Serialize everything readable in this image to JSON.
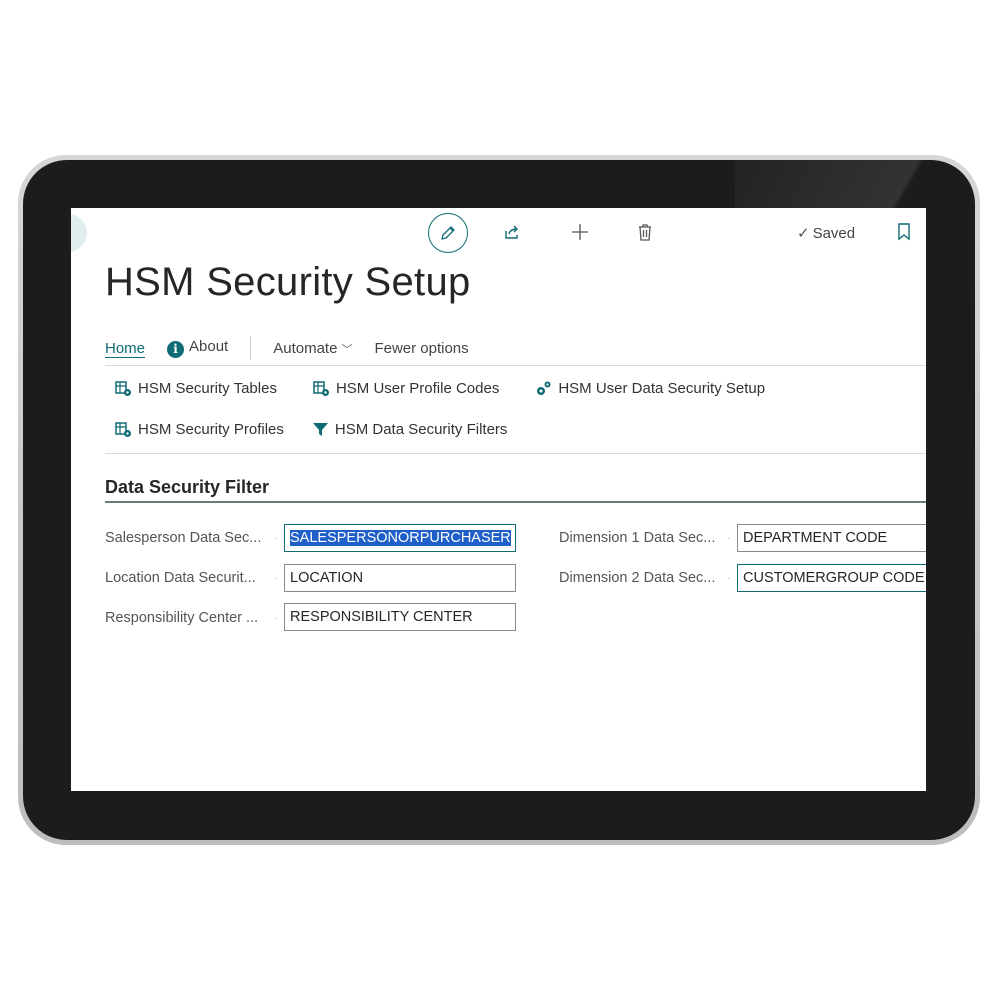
{
  "toolbar": {
    "saved_label": "Saved",
    "edit_icon": "pencil-icon",
    "share_icon": "share-icon",
    "new_icon": "plus-icon",
    "delete_icon": "trash-icon",
    "bookmark_icon": "bookmark-icon"
  },
  "page": {
    "title": "HSM Security Setup"
  },
  "tabs": {
    "home": "Home",
    "about": "About",
    "automate": "Automate",
    "fewer": "Fewer options"
  },
  "actions": {
    "security_tables": "HSM Security Tables",
    "user_profile_codes": "HSM User Profile Codes",
    "user_data_security_setup": "HSM User Data Security Setup",
    "security_profiles": "HSM Security Profiles",
    "data_security_filters": "HSM Data Security Filters"
  },
  "section": {
    "title": "Data Security Filter"
  },
  "fields": {
    "salesperson": {
      "label": "Salesperson Data Sec...",
      "value": "SALESPERSONORPURCHASER"
    },
    "location": {
      "label": "Location Data Securit...",
      "value": "LOCATION"
    },
    "responsibility": {
      "label": "Responsibility Center ...",
      "value": "RESPONSIBILITY CENTER"
    },
    "dimension1": {
      "label": "Dimension 1 Data Sec...",
      "value": "DEPARTMENT CODE"
    },
    "dimension2": {
      "label": "Dimension 2 Data Sec...",
      "value": "CUSTOMERGROUP CODE"
    }
  },
  "colors": {
    "accent": "#0f6b74",
    "selection": "#1f5fc9"
  }
}
